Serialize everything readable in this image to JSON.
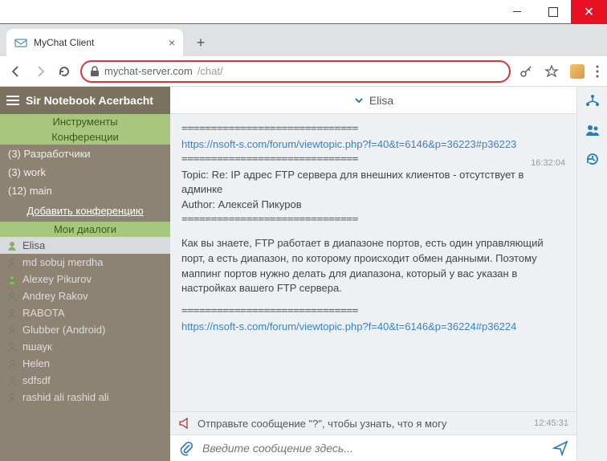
{
  "window": {
    "title": "MyChat Client"
  },
  "browser": {
    "tab_title": "MyChat Client",
    "url_host": "mychat-server.com",
    "url_path": "/chat/"
  },
  "sidebar": {
    "username": "Sir Notebook Acerbacht",
    "sections": {
      "tools": "Инструменты",
      "confs": "Конференции",
      "dialogs": "Мои диалоги"
    },
    "conferences": [
      {
        "count": "(3)",
        "name": "Разработчики"
      },
      {
        "count": "(3)",
        "name": "work"
      },
      {
        "count": "(12)",
        "name": "main"
      }
    ],
    "add_conf": "Добавить конференцию",
    "dialogs": [
      {
        "name": "Elisa",
        "presence": "online",
        "active": true
      },
      {
        "name": "md sobuj merdha",
        "presence": "offline"
      },
      {
        "name": "Alexey Pikurov",
        "presence": "online"
      },
      {
        "name": "Andrey Rakov",
        "presence": "offline"
      },
      {
        "name": "RABOTA",
        "presence": "offline"
      },
      {
        "name": "Glubber (Android)",
        "presence": "offline"
      },
      {
        "name": "пшаук",
        "presence": "offline"
      },
      {
        "name": "Helen",
        "presence": "offline"
      },
      {
        "name": "sdfsdf",
        "presence": "offline"
      },
      {
        "name": "rashid ali rashid ali",
        "presence": "offline"
      }
    ]
  },
  "chat": {
    "peer": "Elisa",
    "sep": "==============================",
    "link1": "https://nsoft-s.com/forum/viewtopic.php?f=40&t=6146&p=36223#p36223",
    "time1": "16:32:04",
    "topic_line": "Topic: Re: IP адрес FTP сервера для внешних клиентов - отсутствует в админке",
    "author_line": "Author: Алексей Пикуров",
    "body": "Как вы знаете, FTP работает в диапазоне портов, есть один управляющий порт, а есть диапазон, по которому происходит обмен данными. Поэтому маппинг портов нужно делать для диапазона, который у вас указан в настройках вашего FTP сервера.",
    "link2": "https://nsoft-s.com/forum/viewtopic.php?f=40&t=6146&p=36224#p36224",
    "bot_hint": "Отправьте сообщение \"?\", чтобы узнать, что я могу",
    "time2": "12:45:31",
    "placeholder": "Введите сообщение здесь..."
  }
}
